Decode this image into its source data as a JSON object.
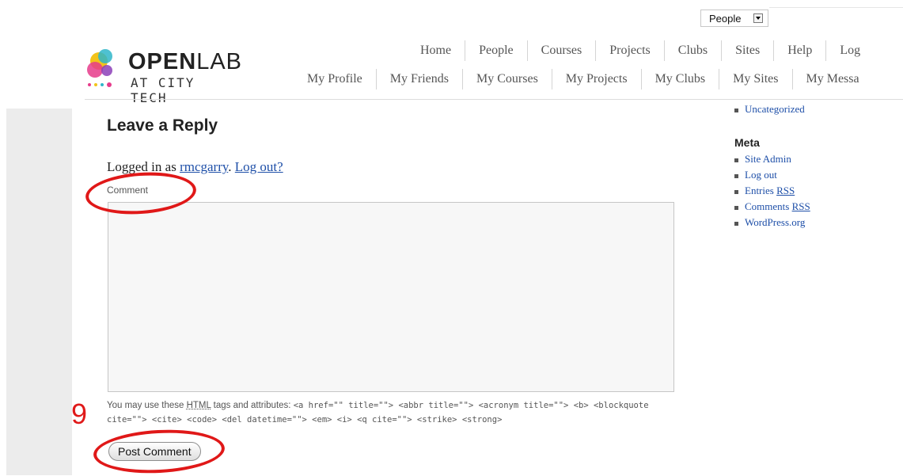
{
  "search": {
    "selected": "People"
  },
  "logo": {
    "title_bold": "OPEN",
    "title_light": "LAB",
    "subtitle": "AT CITY TECH"
  },
  "nav_primary": [
    "Home",
    "People",
    "Courses",
    "Projects",
    "Clubs",
    "Sites",
    "Help",
    "Log"
  ],
  "nav_secondary": [
    "My Profile",
    "My Friends",
    "My Courses",
    "My Projects",
    "My Clubs",
    "My Sites",
    "My Messa"
  ],
  "reply": {
    "title": "Leave a Reply",
    "logged_prefix": "Logged in as ",
    "username": "rmcgarry",
    "logout": "Log out?",
    "comment_label": "Comment",
    "tags_intro": "You may use these ",
    "tags_abbr": "HTML",
    "tags_mid": " tags and attributes: ",
    "tags_list": "<a href=\"\" title=\"\"> <abbr title=\"\"> <acronym title=\"\"> <b> <blockquote cite=\"\"> <cite> <code> <del datetime=\"\"> <em> <i> <q cite=\"\"> <strike> <strong>",
    "submit": "Post Comment"
  },
  "sidebar": {
    "top_item": "Uncategorized",
    "meta_heading": "Meta",
    "meta_items": [
      "Site Admin",
      "Log out",
      "Entries",
      "Comments",
      "WordPress.org"
    ],
    "rss": "RSS"
  },
  "annotation": {
    "step_number": "9",
    "color": "#e01818"
  }
}
